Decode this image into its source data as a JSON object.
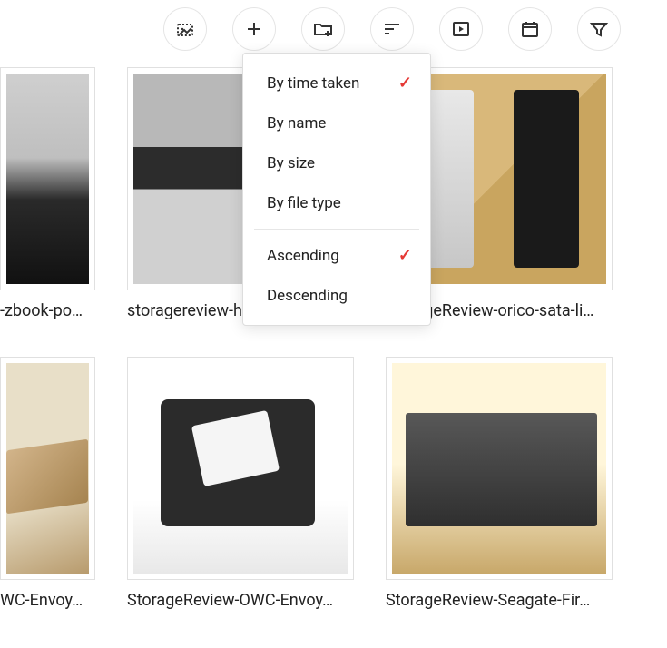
{
  "toolbar": {
    "buttons": [
      {
        "name": "select-image-icon"
      },
      {
        "name": "add-icon"
      },
      {
        "name": "new-folder-icon"
      },
      {
        "name": "sort-icon"
      },
      {
        "name": "slideshow-icon"
      },
      {
        "name": "calendar-icon"
      },
      {
        "name": "filter-icon"
      }
    ]
  },
  "sortMenu": {
    "items": [
      {
        "label": "By time taken",
        "selected": true
      },
      {
        "label": "By name",
        "selected": false
      },
      {
        "label": "By size",
        "selected": false
      },
      {
        "label": "By file type",
        "selected": false
      }
    ],
    "direction": [
      {
        "label": "Ascending",
        "selected": true
      },
      {
        "label": "Descending",
        "selected": false
      }
    ]
  },
  "grid": {
    "tiles": [
      {
        "caption": "-zbook-po…",
        "imgClass": "img1",
        "partial": true
      },
      {
        "caption": "storagereview-hp-zbook-po…",
        "imgClass": "img2",
        "partial": false
      },
      {
        "caption": "StorageReview-orico-sata-li…",
        "imgClass": "img3",
        "partial": false
      },
      {
        "caption": "WC-Envoy…",
        "imgClass": "img4",
        "partial": true
      },
      {
        "caption": "StorageReview-OWC-Envoy…",
        "imgClass": "img5",
        "partial": false
      },
      {
        "caption": "StorageReview-Seagate-Fir…",
        "imgClass": "img6",
        "partial": false
      }
    ]
  }
}
